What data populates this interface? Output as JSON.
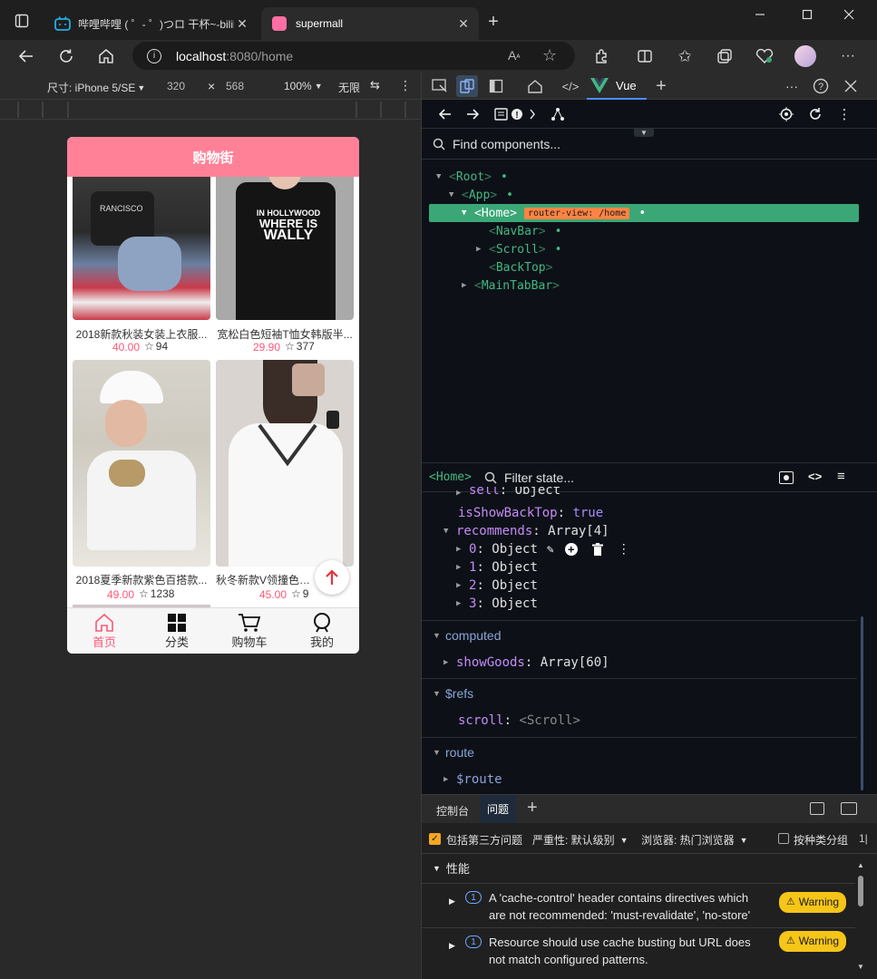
{
  "browser": {
    "tabs": [
      {
        "label": "哔哩哔哩 ( ゜- ゜)つロ 干杯~-bilibili"
      },
      {
        "label": "supermall"
      }
    ],
    "url_host": "localhost",
    "url_rest": ":8080/home",
    "reader_label": "Aᵃ"
  },
  "device_toolbar": {
    "size_label": "尺寸: iPhone 5/SE",
    "width": "320",
    "times": "×",
    "height": "568",
    "zoom": "100%",
    "throttle": "无限"
  },
  "app": {
    "nav_title": "购物街",
    "goods": [
      {
        "title": "2018新款秋装女装上衣服...",
        "price": "40.00",
        "fav": "94"
      },
      {
        "title": "宽松白色短袖T恤女韩版半...",
        "price": "29.90",
        "fav": "377"
      },
      {
        "title": "2018夏季新款紫色百搭款...",
        "price": "49.00",
        "fav": "1238"
      },
      {
        "title": "秋冬新款V领撞色条纹...",
        "price": "45.00",
        "fav": "9"
      }
    ],
    "tabbar": [
      {
        "label": "首页"
      },
      {
        "label": "分类"
      },
      {
        "label": "购物车"
      },
      {
        "label": "我的"
      }
    ],
    "colors": {
      "accent": "#ff8198",
      "price": "#ff5777"
    }
  },
  "devtools": {
    "vue_tab": "Vue",
    "find_placeholder": "Find components...",
    "tree": {
      "root": "Root",
      "app": "App",
      "home": "Home",
      "router_badge": "router-view: /home",
      "navbar": "NavBar",
      "scroll": "Scroll",
      "backtop": "BackTop",
      "maintabbar": "MainTabBar"
    },
    "state": {
      "component": "<Home>",
      "filter_placeholder": "Filter state...",
      "sell_key": "sell",
      "sell_val": "Object",
      "isShowBackTop_key": "isShowBackTop",
      "isShowBackTop_val": "true",
      "recommends_key": "recommends",
      "recommends_val": "Array[4]",
      "items": [
        {
          "key": "0",
          "val": "Object"
        },
        {
          "key": "1",
          "val": "Object"
        },
        {
          "key": "2",
          "val": "Object"
        },
        {
          "key": "3",
          "val": "Object"
        }
      ],
      "computed_label": "computed",
      "showGoods_key": "showGoods",
      "showGoods_val": "Array[60]",
      "refs_label": "$refs",
      "scroll_key": "scroll",
      "scroll_val": "<Scroll>",
      "route_label": "route",
      "route_key": "$route"
    },
    "drawer": {
      "tab_console": "控制台",
      "tab_issues": "问题",
      "include_third_party": "包括第三方问题",
      "severity": "严重性: 默认级别",
      "browser": "浏览器: 热门浏览器",
      "group_by": "按种类分组",
      "group_perf": "性能",
      "issues": [
        {
          "count": "1",
          "line1": "A 'cache-control' header contains directives which",
          "line2": "are not recommended: 'must-revalidate', 'no-store'",
          "badge": "Warning"
        },
        {
          "count": "1",
          "line1": "Resource should use cache busting but URL does",
          "line2": "not match configured patterns.",
          "badge": "Warning"
        }
      ]
    }
  }
}
